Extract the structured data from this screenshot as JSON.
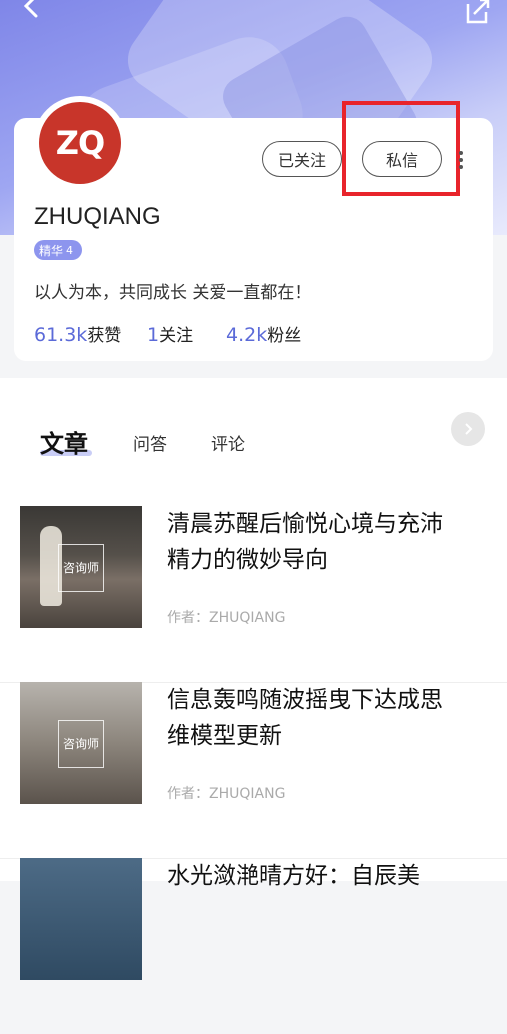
{
  "profile": {
    "avatar_text": "ZQ",
    "follow_label": "已关注",
    "message_label": "私信",
    "name": "ZHUQIANG",
    "badge_label": "精华",
    "badge_level": "4",
    "bio": "以人为本，共同成长 关爱一直都在！",
    "stats": [
      {
        "value": "61.3k",
        "label": "获赞"
      },
      {
        "value": "1",
        "label": "关注"
      },
      {
        "value": "4.2k",
        "label": "粉丝"
      }
    ]
  },
  "tabs": [
    "文章",
    "问答",
    "评论"
  ],
  "articles": [
    {
      "title": "清晨苏醒后愉悦心境与充沛精力的微妙导向",
      "author": "作者：ZHUQIANG",
      "thumb_tag": "咨询师"
    },
    {
      "title": "信息轰鸣随波摇曳下达成思维模型更新",
      "author": "作者：ZHUQIANG",
      "thumb_tag": "咨询师"
    },
    {
      "title": "水光潋滟晴方好：自辰美",
      "author": "",
      "thumb_tag": ""
    }
  ],
  "colors": {
    "accent": "#5b6ad8",
    "highlight": "#e8242b",
    "avatar_bg": "#c8352a"
  }
}
